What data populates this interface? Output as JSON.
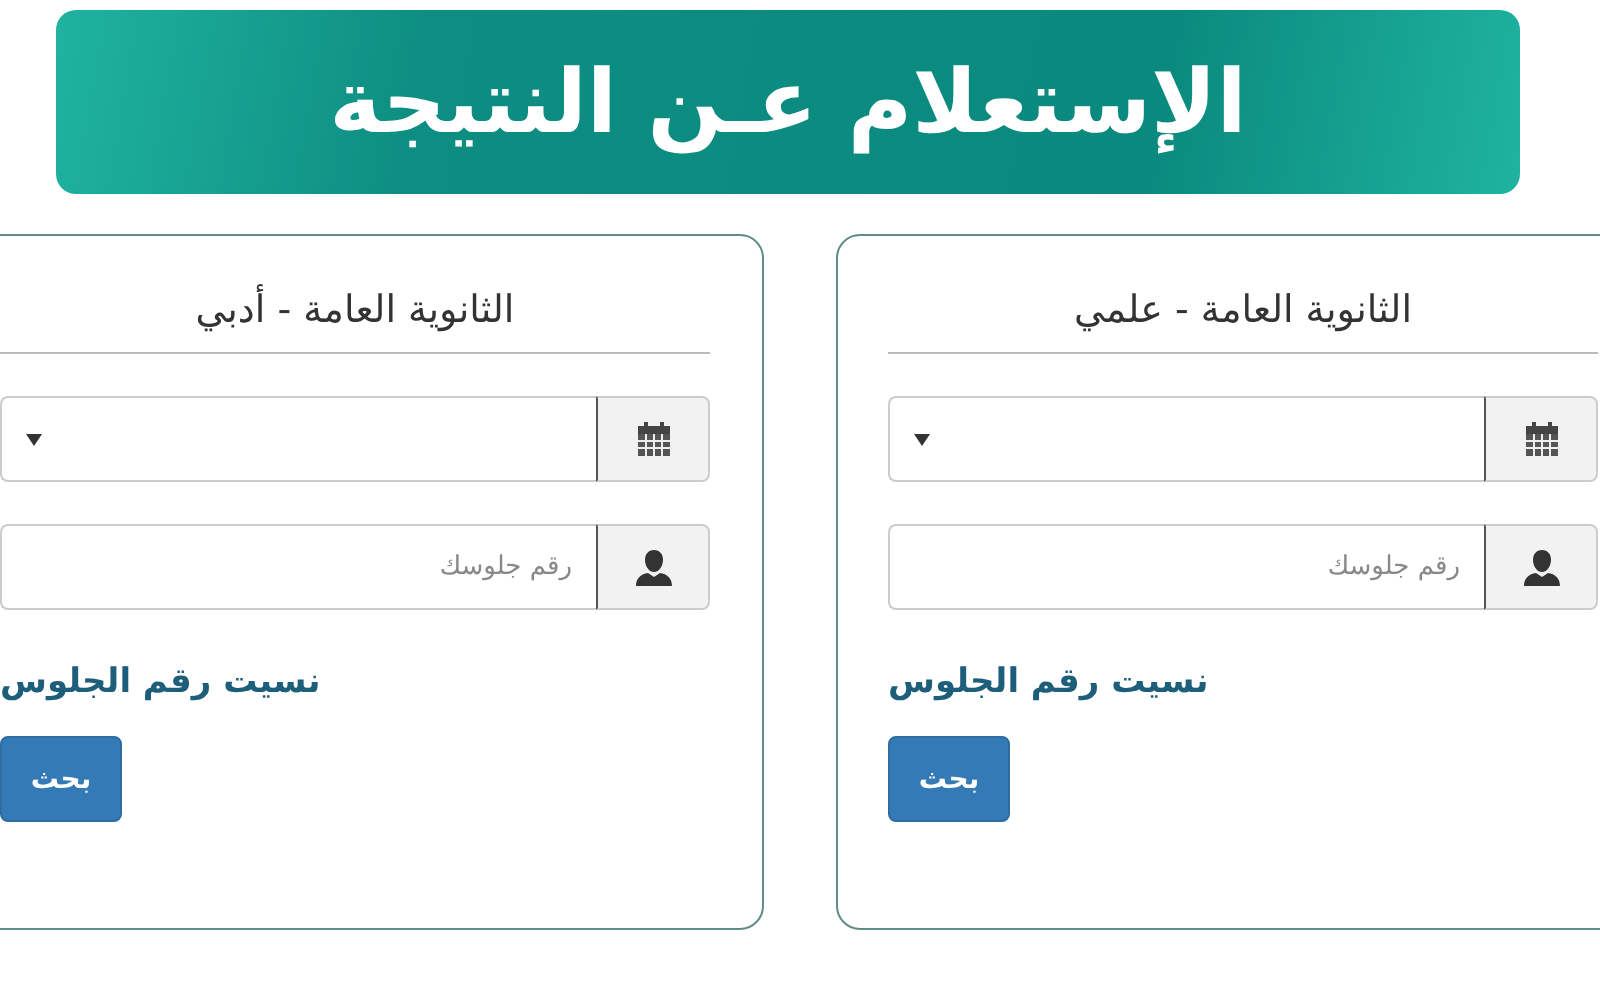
{
  "banner": {
    "title": "الإستعلام عـن النتيجة"
  },
  "cards": [
    {
      "title": "الثانوية العامة - علمي",
      "seat_field": {
        "placeholder": "رقم جلوسك"
      },
      "link": "نسيت رقم الجلوس",
      "button": "بحث"
    },
    {
      "title": "الثانوية العامة - أدبي",
      "seat_field": {
        "placeholder": "رقم جلوسك"
      },
      "link": "نسيت رقم الجلوس",
      "button": "بحث"
    }
  ]
}
